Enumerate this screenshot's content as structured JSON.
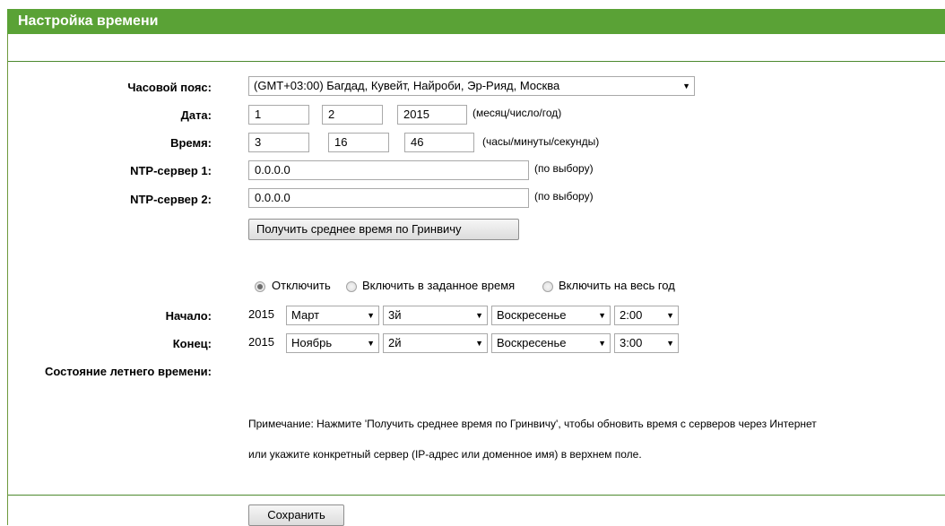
{
  "title": "Настройка времени",
  "timezone": {
    "label": "Часовой пояс:",
    "value": "(GMT+03:00) Багдад, Кувейт, Найроби, Эр-Рияд, Москва"
  },
  "date": {
    "label": "Дата:",
    "month": "1",
    "day": "2",
    "year": "2015",
    "hint": "(месяц/число/год)"
  },
  "time": {
    "label": "Время:",
    "hours": "3",
    "minutes": "16",
    "seconds": "46",
    "hint": "(часы/минуты/секунды)"
  },
  "ntp1": {
    "label": "NTP-сервер 1:",
    "value": "0.0.0.0",
    "hint": "(по выбору)"
  },
  "ntp2": {
    "label": "NTP-сервер 2:",
    "value": "0.0.0.0",
    "hint": "(по выбору)"
  },
  "gmt_button": "Получить среднее время по Гринвичу",
  "dst_mode": {
    "options": [
      "Отключить",
      "Включить в заданное время",
      "Включить на весь год"
    ],
    "selected": 0
  },
  "dst_start": {
    "label": "Начало:",
    "year": "2015",
    "month": "Март",
    "week": "3й",
    "weekday": "Воскресенье",
    "time": "2:00"
  },
  "dst_end": {
    "label": "Конец:",
    "year": "2015",
    "month": "Ноябрь",
    "week": "2й",
    "weekday": "Воскресенье",
    "time": "3:00"
  },
  "dst_status_label": "Состояние летнего времени:",
  "note": {
    "line1": "Примечание: Нажмите 'Получить среднее время по Гринвичу', чтобы обновить время с серверов через Интернет",
    "line2": "или укажите конкретный сервер (IP-адрес или доменное имя) в верхнем поле."
  },
  "save_button": "Сохранить",
  "colors": {
    "header_green": "#5aa236",
    "rule_green": "#4c8a2e"
  }
}
